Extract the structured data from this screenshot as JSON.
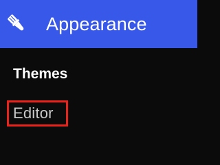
{
  "header": {
    "title": "Appearance",
    "icon": "paintbrush-icon",
    "background_color": "#3858e9",
    "text_color": "#ffffff"
  },
  "submenu": {
    "items": [
      {
        "label": "Themes",
        "state": "current"
      },
      {
        "label": "Editor",
        "state": "highlighted"
      }
    ],
    "background_color": "#0b0b0b",
    "highlight_color": "#e7231c"
  }
}
